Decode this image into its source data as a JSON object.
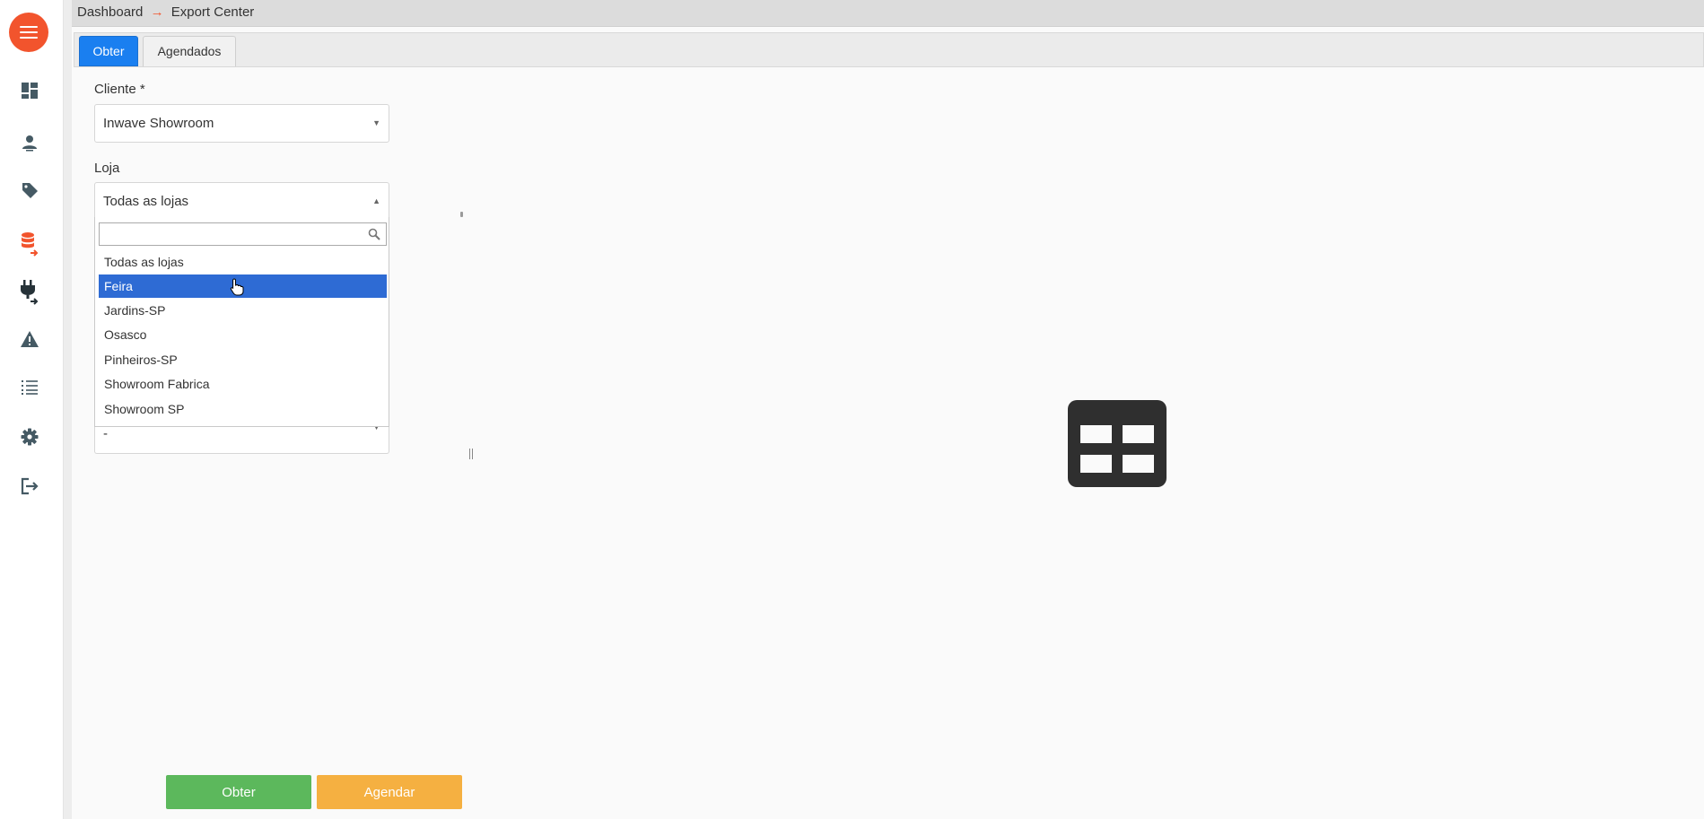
{
  "breadcrumb": {
    "root": "Dashboard",
    "separator": "→",
    "current": "Export Center"
  },
  "tabs": [
    {
      "label": "Obter",
      "active": true
    },
    {
      "label": "Agendados",
      "active": false
    }
  ],
  "form": {
    "cliente": {
      "label": "Cliente *",
      "value": "Inwave Showroom"
    },
    "loja": {
      "label": "Loja",
      "value": "Todas as lojas"
    },
    "hidden_field": {
      "value": "-"
    }
  },
  "dropdown": {
    "search_value": "",
    "options": [
      "Todas as lojas",
      "Feira",
      "Jardins-SP",
      "Osasco",
      "Pinheiros-SP",
      "Showroom Fabrica",
      "Showroom SP"
    ],
    "highlighted": "Feira"
  },
  "buttons": {
    "obter": "Obter",
    "agendar": "Agendar"
  },
  "sidebar": {
    "items": [
      "dashboard-icon",
      "user-icon",
      "tag-icon",
      "database-export-icon",
      "plug-export-icon",
      "warning-icon",
      "list-icon",
      "gear-icon",
      "logout-icon"
    ],
    "active": "database-export-icon"
  },
  "colors": {
    "accent": "#f2542d",
    "tab_active": "#1a7ff0",
    "highlight": "#2e6bd4",
    "button_green": "#5cb85c",
    "button_orange": "#f5b041"
  }
}
